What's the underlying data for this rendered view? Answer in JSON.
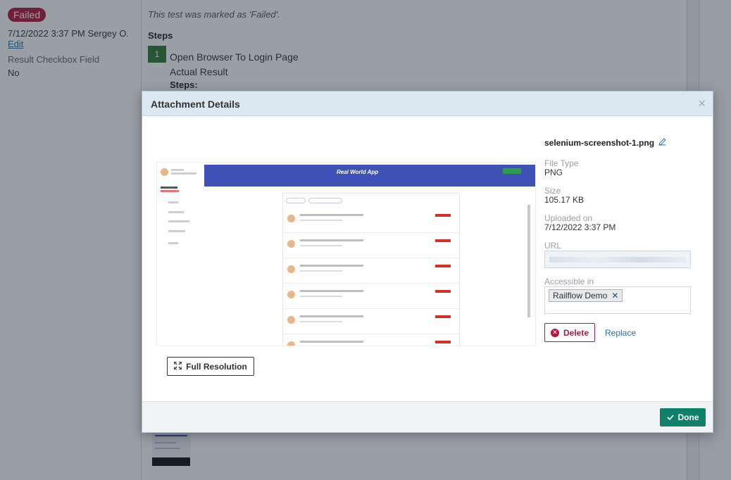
{
  "background": {
    "status_badge": "Failed",
    "meta_text": "7/12/2022 3:37 PM Sergey O.",
    "edit_link": "Edit",
    "field_label": "Result Checkbox Field",
    "field_value": "No",
    "note": "This test was marked as 'Failed'.",
    "steps_heading": "Steps",
    "step_number": "1",
    "step_title": "Open Browser To Login Page",
    "step_actual": "Actual Result",
    "step_sub": "Steps:"
  },
  "modal": {
    "title": "Attachment Details",
    "close_glyph": "×",
    "preview_app_title": "Real World App",
    "full_resolution_label": "Full Resolution",
    "file_name": "selenium-screenshot-1.png",
    "file_type_label": "File Type",
    "file_type_value": "PNG",
    "size_label": "Size",
    "size_value": "105.17 KB",
    "uploaded_label": "Uploaded on",
    "uploaded_value": "7/12/2022 3:37 PM",
    "url_label": "URL",
    "accessible_label": "Accessible in",
    "tag_label": "Railflow Demo",
    "delete_label": "Delete",
    "replace_label": "Replace",
    "done_label": "Done"
  },
  "icons": {
    "edit": "pencil-icon",
    "close": "close-icon",
    "expand": "expand-icon",
    "delete": "delete-circle-icon",
    "done": "check-icon"
  },
  "colors": {
    "failed": "#b3173c",
    "done": "#11806a",
    "header": "#dbe7f1",
    "link": "#2a6fb0"
  }
}
